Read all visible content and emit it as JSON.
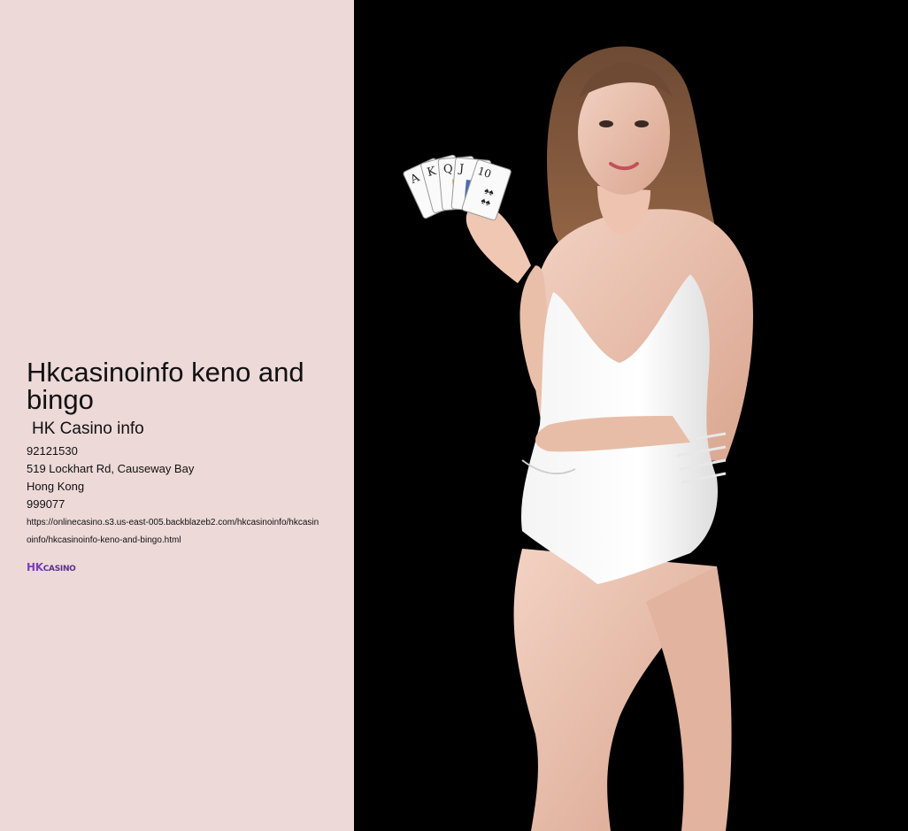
{
  "page": {
    "title": "Hkcasinoinfo keno and bingo"
  },
  "business": {
    "name": "HK Casino info",
    "phone": "92121530",
    "address_line1": "519 Lockhart Rd, Causeway Bay",
    "address_line2": "Hong Kong",
    "postal_code": "999077",
    "url": "https://onlinecasino.s3.us-east-005.backblazeb2.com/hkcasinoinfo/hkcasinoinfo/hkcasinoinfo-keno-and-bingo.html"
  },
  "logo": {
    "hk": "HK",
    "casino": "CASINO"
  },
  "hero_image": {
    "card_labels": [
      "A",
      "K",
      "Q",
      "J",
      "10"
    ]
  },
  "colors": {
    "left_background": "#ecd9d8",
    "right_background": "#000000",
    "logo_purple": "#6b3fa0"
  }
}
